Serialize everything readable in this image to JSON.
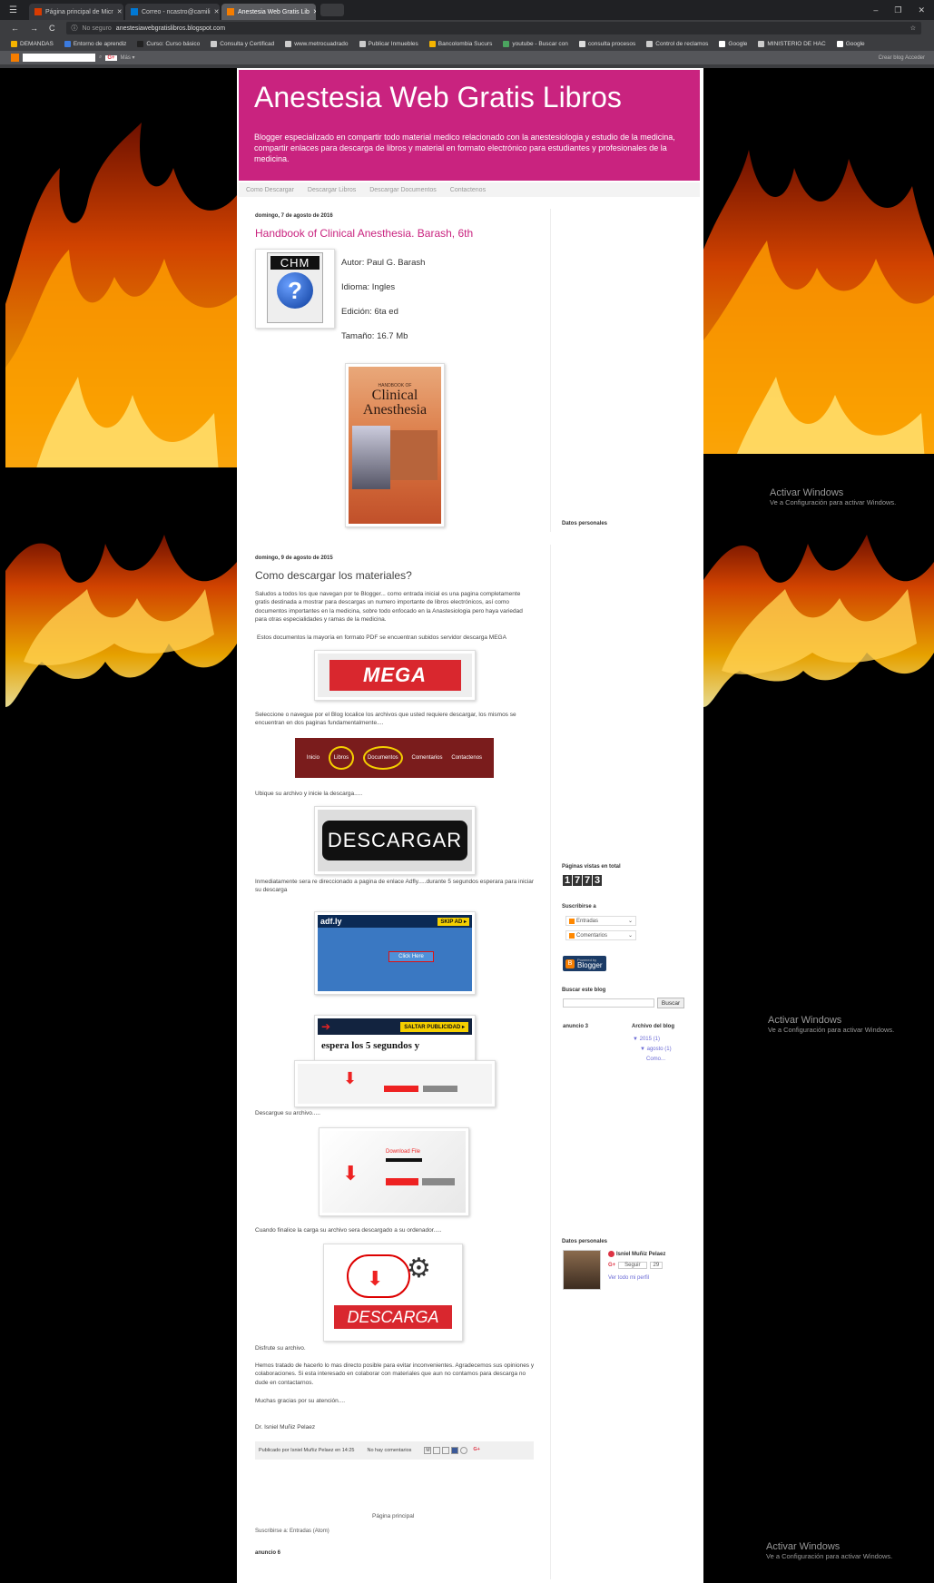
{
  "browser": {
    "tabs": [
      {
        "title": "Página principal de Micr",
        "color": "#d83b01"
      },
      {
        "title": "Correo - ncastro@camili",
        "color": "#0078d4"
      },
      {
        "title": "Anestesia Web Gratis Lib",
        "color": "#f57d00"
      }
    ],
    "address_security": "No seguro",
    "address_url": "anestesiawebgratislibros.blogspot.com",
    "bookmarks": [
      "DEMANDAS",
      "Entorno de aprendiz",
      "Curso: Curso básico",
      "Consulta y Certificad",
      "www.metrocuadrado",
      "Publicar Inmuebles",
      "Bancolombia Sucurs",
      "youtube - Buscar con",
      "consulta procesos",
      "Control de reclamos",
      "Google",
      "MINISTERIO DE HAC",
      "Google"
    ],
    "blogger_nav": {
      "gplus": "G+",
      "more": "Más ▾",
      "right": "Crear blog  Acceder"
    }
  },
  "windows_watermark": {
    "title": "Activar Windows",
    "subtitle": "Ve a Configuración para activar Windows."
  },
  "blog": {
    "title": "Anestesia Web Gratis Libros",
    "description": "Blogger especializado en compartir todo material medico relacionado con la anestesiologia y estudio de la medicina, compartir enlaces para descarga de libros y material en formato electrónico para estudiantes y profesionales de la medicina.",
    "nav": [
      "Como Descargar",
      "Descargar Libros",
      "Descargar Documentos",
      "Contactenos"
    ]
  },
  "post1": {
    "date": "domingo, 7 de agosto de 2016",
    "title": "Handbook of Clinical Anesthesia. Barash, 6th",
    "chm_label": "CHM",
    "author": "Autor: Paul G. Barash",
    "language": "Idioma: Ingles",
    "edition": "Edición: 6ta ed",
    "size": "Tamaño: 16.7 Mb",
    "cover_top": "HANDBOOK OF",
    "cover_title1": "Clinical",
    "cover_title2": "Anesthesia"
  },
  "post2": {
    "date": "domingo, 9 de agosto de 2015",
    "title": "Como descargar los materiales?",
    "p1": "Saludos a todos los que navegan por te Blogger... como entrada inicial es una pagina completamente gratis destinada a mostrar para descargas un numero importante de libros electrónicos, así como documentos importantes en la medicina, sobre todo enfocado en la Anastesiologia pero haya variedad para otras especialidades y ramas de la medicina.",
    "p2": "Estos documentos la mayoría en formato PDF se encuentran subidos servidor descarga MEGA",
    "mega": "MEGA",
    "p3": "Seleccione o navegue por el Blog localice los archivos que usted requiere descargar, los mismos se encuentran en dos paginas fundamentalmente....",
    "menu_items": [
      "Inicio",
      "Libros",
      "Documentos",
      "Comentarios",
      "Contactenos"
    ],
    "p4": "Ubique su archivo y inicie la descarga.....",
    "descargar": "DESCARGAR",
    "p5": "Inmediatamente sera re direccionado a pagina de enlace Adfly.....durante 5 segundos esperara para iniciar su descarga",
    "adfly_logo": "adf.ly",
    "adfly_skip": "SKIP AD ▸",
    "adfly_click": "Click Here",
    "saltar": "SALTAR PUBLICIDAD ▸",
    "espera": "espera los 5 segundos y",
    "p6": "Descargue su archivo.....",
    "download_file": "Download File",
    "p7": "Cuando finalice la carga su archivo sera descargado a su ordenador.....",
    "descarga": "DESCARGA",
    "p8": "Disfrute su archivo.",
    "p9": "Hemos tratado de hacerlo lo mas directo posible para evitar inconvenientes. Agradecemos sus opiniones y colaboraciones. Si esta interesado en colaborar con materiales que aun no contamos para descarga no dude en contactarnos.",
    "p10": "Muchas gracias por su atención....",
    "p11": "Dr. Isniel Muñiz Pelaez",
    "footer_by": "Publicado por Isniel Muñiz Pelaez en 14:25",
    "footer_comments": "No hay comentarios",
    "share_gplus": "G+"
  },
  "sidebar": {
    "datos": "Datos personales",
    "pageviews_title": "Páginas vistas en total",
    "pageviews": [
      "1",
      "7",
      "7",
      "3"
    ],
    "subscribe_title": "Suscribirse a",
    "subscribe_items": [
      "Entradas",
      "Comentarios"
    ],
    "blogger_badge_small": "Powered by",
    "blogger_badge": "Blogger",
    "search_title": "Buscar este blog",
    "search_button": "Buscar",
    "anuncio3": "anuncio 3",
    "archive_title": "Archivo del blog",
    "archive_year": "▼ 2015 (1)",
    "archive_month": "▼ agosto (1)",
    "archive_post": "Como...",
    "profile_name": "Isniel Muñiz Pelaez",
    "follow": "Seguir",
    "follow_count": "29",
    "profile_link": "Ver todo mi perfil"
  },
  "footer": {
    "home": "Página principal",
    "subscribe_prefix": "Suscribirse a:",
    "subscribe_link": "Entradas (Atom)",
    "anuncio6": "anuncio 6"
  },
  "colors": {
    "header": "#c9237f",
    "accent": "#c9237f",
    "mega_red": "#d9272e"
  }
}
